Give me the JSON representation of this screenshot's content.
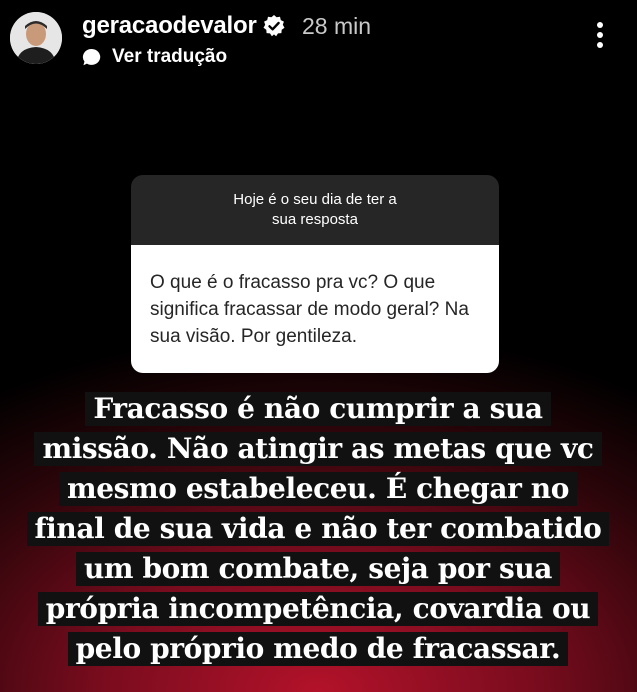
{
  "header": {
    "username": "geracaodevalor",
    "time": "28 min",
    "translate_label": "Ver tradução",
    "verified_icon": "verified-badge-icon",
    "more_icon": "more-vertical-icon"
  },
  "sticker": {
    "prompt": "Hoje é o seu dia de ter a sua resposta",
    "question": "O que é o fracasso pra vc? O que significa fracassar de modo geral? Na sua visão. Por gentileza."
  },
  "answer": {
    "lines": [
      "Fracasso é não cumprir a sua",
      "missão. Não atingir as metas que vc",
      "mesmo estabeleceu. É chegar no",
      "final de sua vida e não ter combatido",
      "um bom combate, seja por sua",
      "própria incompetência, covardia ou",
      "pelo próprio medo de fracassar."
    ]
  },
  "colors": {
    "background_bottom": "#b3122a",
    "sticker_header": "#262626",
    "sticker_body": "#ffffff"
  }
}
